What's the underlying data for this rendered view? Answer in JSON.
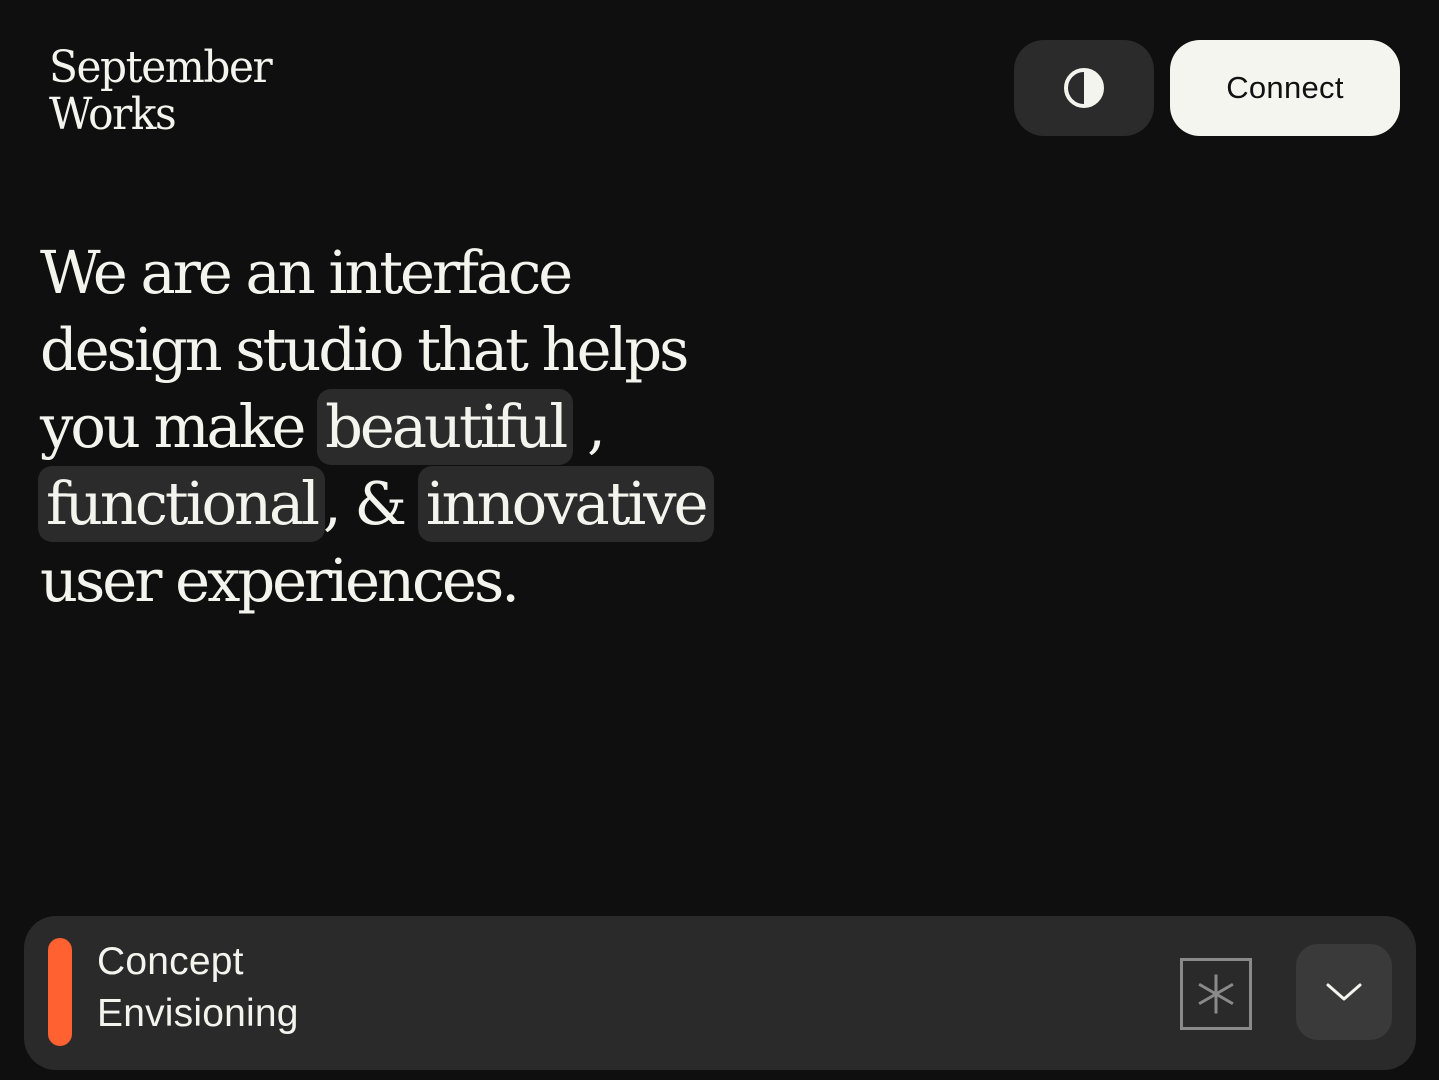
{
  "brand": {
    "name_line1": "September",
    "name_line2": "Works"
  },
  "header": {
    "theme_toggle_icon": "contrast-icon",
    "connect_label": "Connect"
  },
  "hero": {
    "line1": "We are an interface",
    "line2": "design studio that helps",
    "line3_prefix": "you make ",
    "highlight1": "beautiful",
    "line3_suffix": " ,",
    "highlight2": "functional",
    "line4_middle": ", & ",
    "highlight3": "innovative",
    "line5": "user experiences."
  },
  "service": {
    "title_line1": "Concept",
    "title_line2": "Envisioning",
    "accent_color": "#ff6130",
    "badge_icon": "asterisk-icon",
    "expand_icon": "chevron-down-icon"
  },
  "colors": {
    "background": "#0f0f0f",
    "surface": "#2a2a2a",
    "text": "#f4f4ef",
    "button_light": "#f4f5ef"
  }
}
